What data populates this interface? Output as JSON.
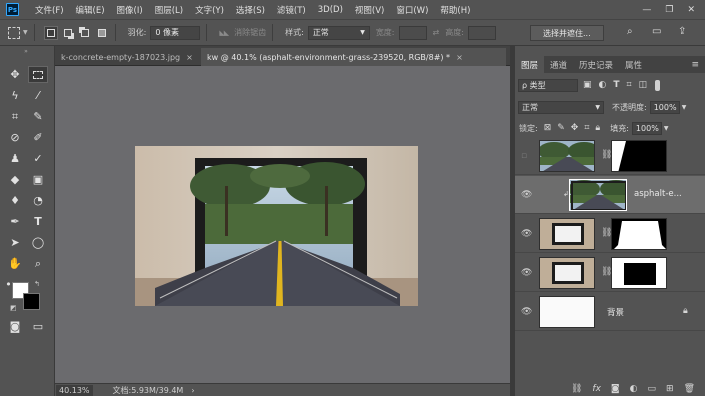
{
  "app": {
    "logo": "Ps"
  },
  "menu": [
    "文件(F)",
    "编辑(E)",
    "图像(I)",
    "图层(L)",
    "文字(Y)",
    "选择(S)",
    "滤镜(T)",
    "3D(D)",
    "视图(V)",
    "窗口(W)",
    "帮助(H)"
  ],
  "window_controls": {
    "minimize": "—",
    "restore": "❐",
    "close": "✕"
  },
  "options": {
    "feather_label": "羽化:",
    "feather_value": "0 像素",
    "antialias_label": "消除锯齿",
    "style_label": "样式:",
    "style_value": "正常",
    "width_label": "宽度:",
    "height_label": "高度:",
    "select_mask_button": "选择并遮住..."
  },
  "tabs": [
    {
      "label": "k-concrete-empty-187023.jpg",
      "close": "×"
    },
    {
      "label": "kw @ 40.1% (asphalt-environment-grass-239520, RGB/8#) *",
      "close": "×"
    }
  ],
  "status": {
    "zoom": "40.13%",
    "doc_info": "文档:5.93M/39.4M",
    "arrow": "›"
  },
  "panel": {
    "tabs": [
      "图层",
      "通道",
      "历史记录",
      "属性"
    ],
    "filter_label": "ρ 类型",
    "blend_mode": "正常",
    "opacity_label": "不透明度:",
    "opacity_value": "100%",
    "lock_label": "锁定:",
    "fill_label": "填充:",
    "fill_value": "100%",
    "layers": [
      {
        "name": "",
        "visible": false
      },
      {
        "name": "asphalt-e...",
        "visible": true,
        "selected": true
      },
      {
        "name": "",
        "visible": true
      },
      {
        "name": "",
        "visible": true
      },
      {
        "name": "背景",
        "visible": true,
        "locked": true
      }
    ],
    "footer_icons": [
      "link-icon",
      "fx-icon",
      "mask-icon",
      "adjustment-icon",
      "group-icon",
      "new-layer-icon",
      "trash-icon"
    ]
  }
}
